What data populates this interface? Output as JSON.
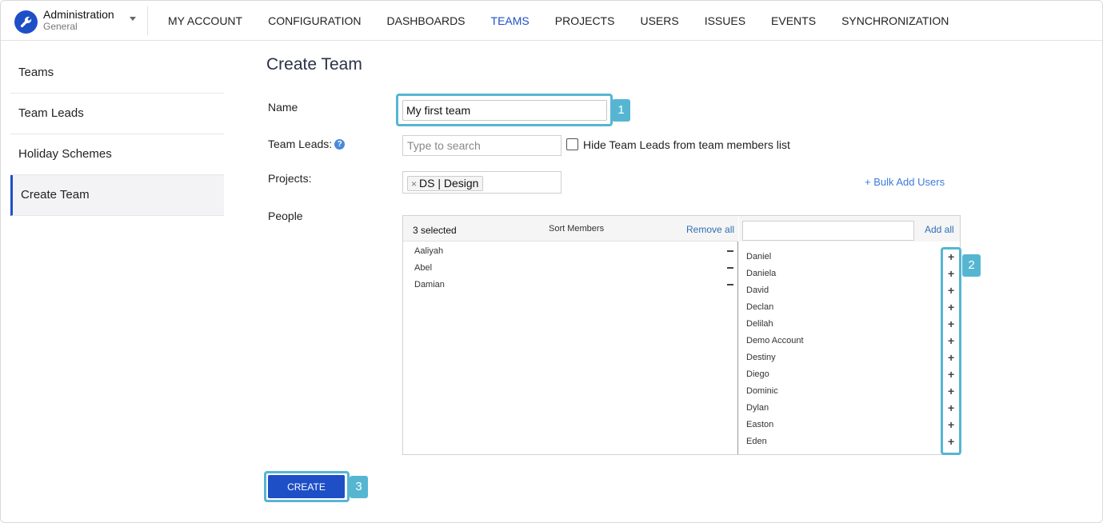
{
  "brand": {
    "title": "Administration",
    "subtitle": "General",
    "icon": "wrench-icon"
  },
  "nav": {
    "items": [
      "MY ACCOUNT",
      "CONFIGURATION",
      "DASHBOARDS",
      "TEAMS",
      "PROJECTS",
      "USERS",
      "ISSUES",
      "EVENTS",
      "SYNCHRONIZATION"
    ],
    "active": "TEAMS"
  },
  "sidebar": {
    "items": [
      {
        "label": "Teams"
      },
      {
        "label": "Team Leads"
      },
      {
        "label": "Holiday Schemes"
      },
      {
        "label": "Create Team"
      }
    ],
    "active": "Create Team"
  },
  "page": {
    "title": "Create Team"
  },
  "form": {
    "name_label": "Name",
    "name_value": "My first team",
    "leads_label": "Team Leads:",
    "leads_help_icon": "question-circle-icon",
    "leads_placeholder": "Type to search",
    "hide_leads_label": "Hide Team Leads from team members list",
    "hide_leads_checked": false,
    "projects_label": "Projects:",
    "project_tags": [
      "DS | Design"
    ],
    "bulk_add_label": "+ Bulk Add Users",
    "people_label": "People"
  },
  "people": {
    "selected_count": "3 selected",
    "sort_label": "Sort Members",
    "remove_all_label": "Remove all",
    "add_all_label": "Add all",
    "selected": [
      "Aaliyah",
      "Abel",
      "Damian"
    ],
    "available": [
      "Daniel",
      "Daniela",
      "David",
      "Declan",
      "Delilah",
      "Demo Account",
      "Destiny",
      "Diego",
      "Dominic",
      "Dylan",
      "Easton",
      "Eden"
    ]
  },
  "callouts": [
    "1",
    "2",
    "3"
  ],
  "actions": {
    "create_label": "CREATE"
  },
  "colors": {
    "accent": "#1f4fc7",
    "highlight": "#56b6d2",
    "link": "#2e6fb5"
  }
}
